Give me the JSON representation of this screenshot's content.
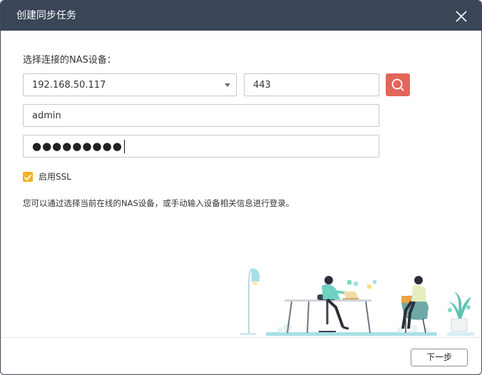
{
  "dialog": {
    "title": "创建同步任务",
    "close_icon": "close-icon"
  },
  "form": {
    "nas_label": "选择连接的NAS设备：",
    "nas_ip": "192.168.50.117",
    "port": "443",
    "username": "admin",
    "password_mask": "●●●●●●●●●",
    "search_icon": "search-icon",
    "ssl_label": "启用SSL",
    "ssl_enabled": true,
    "hint": "您可以通过选择当前在线的NAS设备，或手动输入设备相关信息进行登录。"
  },
  "footer": {
    "next_label": "下一步"
  },
  "colors": {
    "titlebar": "#3a4557",
    "search_button": "#e2665a",
    "checkbox": "#f0b323",
    "illustration_accent": "#a8dfe6"
  }
}
